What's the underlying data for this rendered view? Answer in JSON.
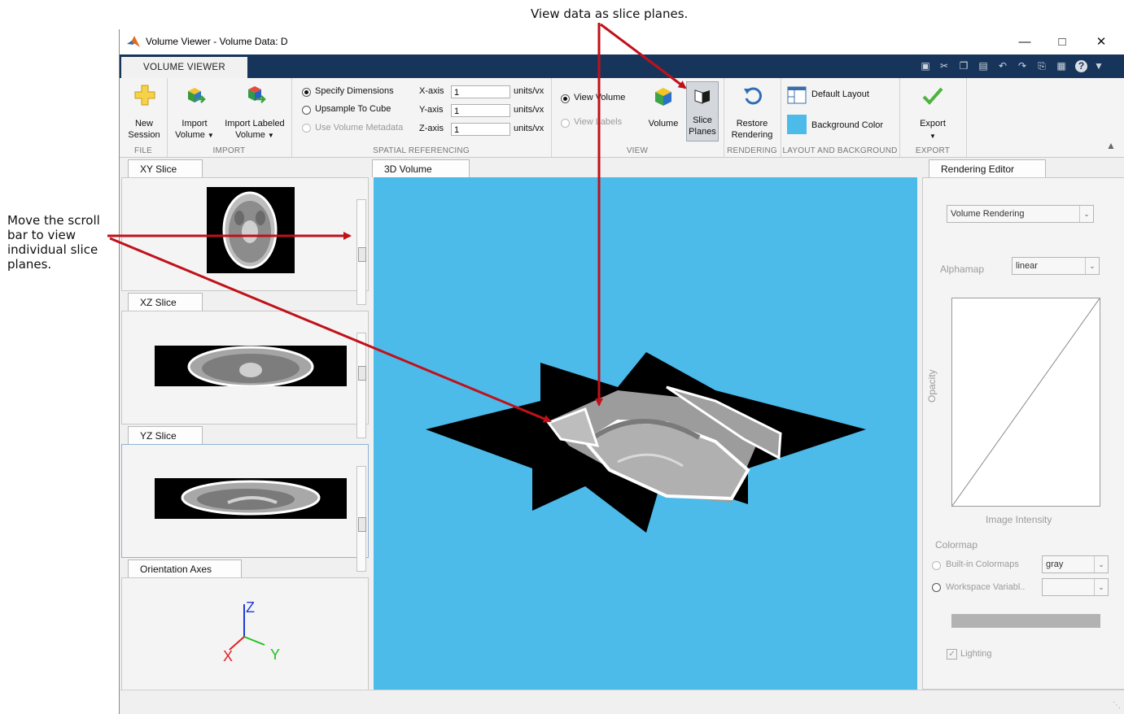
{
  "callouts": {
    "top": "View data as slice planes.",
    "left": [
      "Move the scroll",
      "bar to view",
      "individual slice",
      "planes."
    ]
  },
  "window": {
    "title": "Volume Viewer - Volume Data: D",
    "tab": "VOLUME VIEWER"
  },
  "ribbon": {
    "file": {
      "new_session": [
        "New",
        "Session"
      ],
      "label": "FILE"
    },
    "import": {
      "import_volume": [
        "Import",
        "Volume"
      ],
      "import_labeled": [
        "Import Labeled",
        "Volume"
      ],
      "label": "IMPORT"
    },
    "spatial": {
      "specify_dimensions": "Specify Dimensions",
      "upsample": "Upsample To Cube",
      "use_metadata": "Use Volume Metadata",
      "x_axis": "X-axis",
      "y_axis": "Y-axis",
      "z_axis": "Z-axis",
      "x_value": "1",
      "y_value": "1",
      "z_value": "1",
      "units": "units/vx",
      "label": "SPATIAL REFERENCING"
    },
    "view": {
      "view_volume": "View Volume",
      "view_labels": "View Labels",
      "volume": "Volume",
      "slice_planes": [
        "Slice",
        "Planes"
      ],
      "label": "VIEW"
    },
    "rendering": {
      "restore": [
        "Restore",
        "Rendering"
      ],
      "label": "RENDERING"
    },
    "layout": {
      "default_layout": "Default Layout",
      "background_color": "Background Color",
      "label": "LAYOUT AND BACKGROUND",
      "bg_swatch": "#4cbbea"
    },
    "export": {
      "export": "Export",
      "label": "EXPORT"
    }
  },
  "left_panels": {
    "xy": "XY Slice",
    "xz": "XZ Slice",
    "yz": "YZ Slice",
    "axes": "Orientation Axes",
    "axis_x": "X",
    "axis_y": "Y",
    "axis_z": "Z"
  },
  "center": {
    "tab": "3D Volume",
    "background": "#4cbbea"
  },
  "rendering_editor": {
    "tab": "Rendering Editor",
    "renderer": "Volume Rendering",
    "alphamap_label": "Alphamap",
    "alphamap": "linear",
    "opacity_label": "Opacity",
    "intensity_label": "Image Intensity",
    "colormap_label": "Colormap",
    "builtin": "Built-in Colormaps",
    "builtin_value": "gray",
    "workspace": "Workspace Variabl..",
    "lighting": "Lighting"
  },
  "colors": {
    "arrow": "#c0111a",
    "ribbon_bar": "#17355b",
    "accent": "#4cbbea"
  }
}
